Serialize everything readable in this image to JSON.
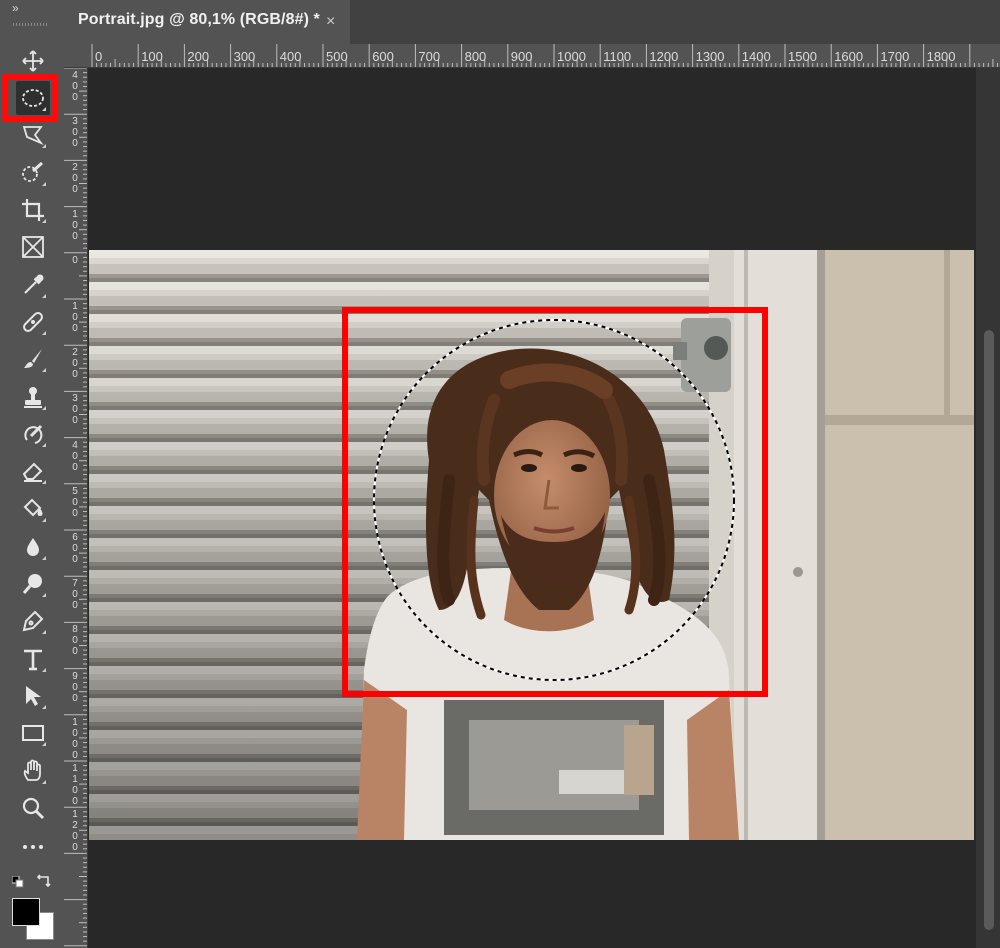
{
  "window": {
    "collapse_glyph": "»",
    "document_tab": {
      "title": "Portrait.jpg @ 80,1% (RGB/8#) *",
      "close_glyph": "×"
    }
  },
  "toolbar": {
    "tools": [
      {
        "name": "move-tool",
        "icon": "move-icon"
      },
      {
        "name": "elliptical-marquee-tool",
        "icon": "elliptical-marquee-icon",
        "active": true
      },
      {
        "name": "lasso-tool",
        "icon": "polygonal-lasso-icon"
      },
      {
        "name": "quick-selection-tool",
        "icon": "quick-selection-icon"
      },
      {
        "name": "crop-tool",
        "icon": "crop-icon"
      },
      {
        "name": "frame-tool",
        "icon": "frame-icon"
      },
      {
        "name": "eyedropper-tool",
        "icon": "eyedropper-icon"
      },
      {
        "name": "healing-brush-tool",
        "icon": "bandage-icon"
      },
      {
        "name": "brush-tool",
        "icon": "brush-icon"
      },
      {
        "name": "clone-stamp-tool",
        "icon": "stamp-icon"
      },
      {
        "name": "history-brush-tool",
        "icon": "history-brush-icon"
      },
      {
        "name": "eraser-tool",
        "icon": "eraser-icon"
      },
      {
        "name": "paint-bucket-tool",
        "icon": "paint-bucket-icon"
      },
      {
        "name": "blur-tool",
        "icon": "drop-icon"
      },
      {
        "name": "dodge-tool",
        "icon": "dodge-icon"
      },
      {
        "name": "pen-tool",
        "icon": "pen-icon"
      },
      {
        "name": "type-tool",
        "icon": "type-icon",
        "label": "T"
      },
      {
        "name": "path-selection-tool",
        "icon": "arrow-icon"
      },
      {
        "name": "rectangle-tool",
        "icon": "rectangle-icon"
      },
      {
        "name": "hand-tool",
        "icon": "hand-icon"
      },
      {
        "name": "zoom-tool",
        "icon": "zoom-icon"
      },
      {
        "name": "edit-toolbar",
        "icon": "more-icon"
      }
    ],
    "colors": {
      "foreground": "#000000",
      "background": "#ffffff"
    }
  },
  "rulers": {
    "horizontal": [
      "0",
      "100",
      "200",
      "300",
      "400",
      "500",
      "600",
      "700",
      "800",
      "900",
      "1000",
      "1100",
      "1200",
      "1300",
      "1400",
      "1500",
      "1600",
      "1700",
      "1800"
    ],
    "vertical": [
      "400",
      "300",
      "200",
      "100",
      "0",
      "100",
      "200",
      "300",
      "400",
      "500",
      "600",
      "700",
      "800",
      "900",
      "1000",
      "1100",
      "1200"
    ]
  },
  "colors": {
    "highlight": "#ff0000",
    "panel": "#535353",
    "canvas_bg": "#282828"
  }
}
